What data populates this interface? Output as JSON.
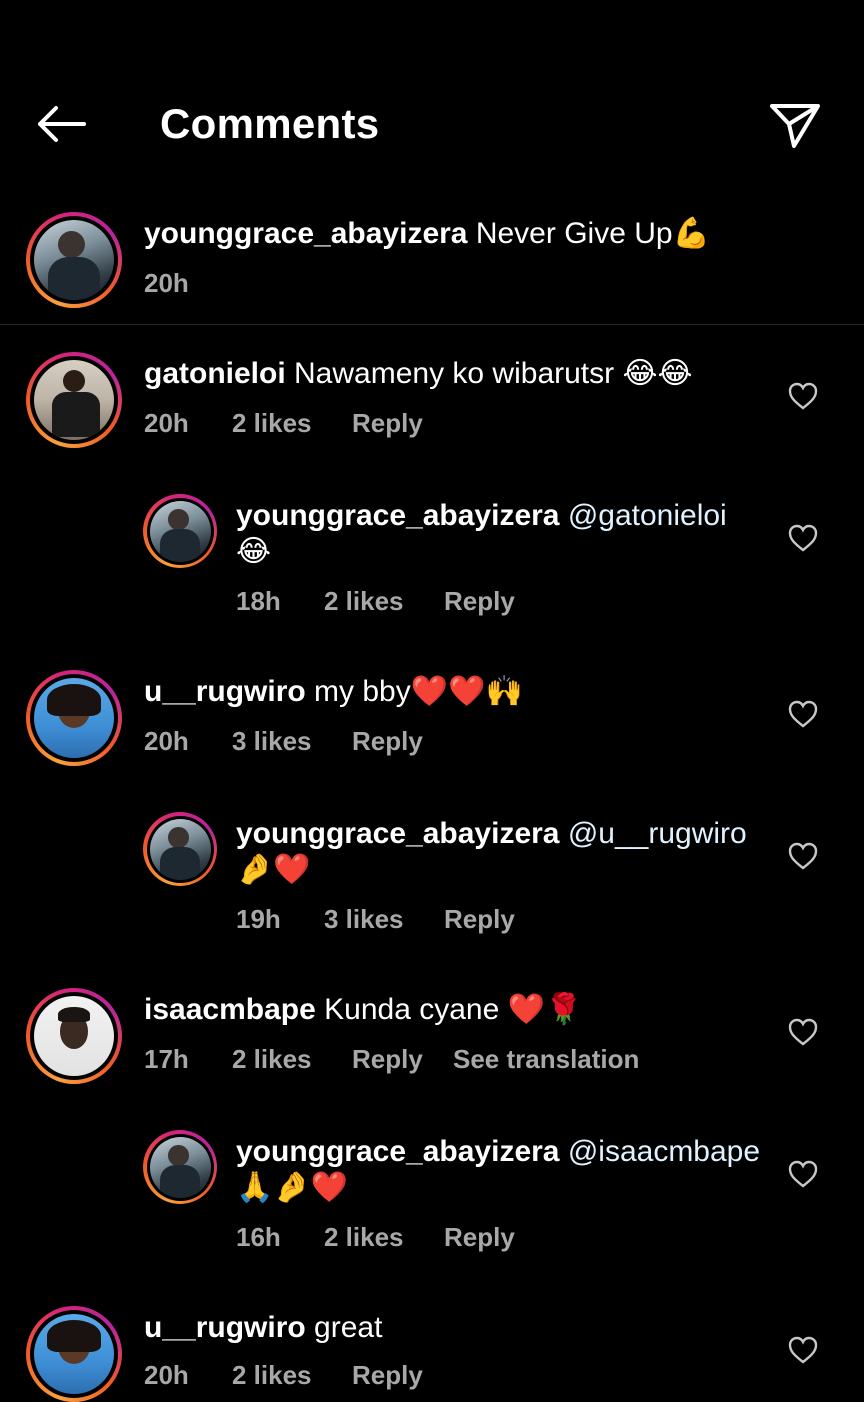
{
  "header": {
    "title": "Comments",
    "back_icon": "arrow-left-icon",
    "send_icon": "paper-plane-icon"
  },
  "caption": {
    "username": "younggrace_abayizera",
    "text": "Never Give Up💪",
    "time": "20h"
  },
  "comments": [
    {
      "username": "gatonieloi",
      "text": "Nawameny ko wibarutsr 😂😂",
      "time": "20h",
      "likes": "2 likes",
      "reply": "Reply",
      "reply_comment": {
        "username": "younggrace_abayizera",
        "mention": "@gatonieloi",
        "text": "😂",
        "time": "18h",
        "likes": "2 likes",
        "reply": "Reply"
      }
    },
    {
      "username": "u__rugwiro",
      "text": "my bby❤️❤️🙌",
      "time": "20h",
      "likes": "3 likes",
      "reply": "Reply",
      "reply_comment": {
        "username": "younggrace_abayizera",
        "mention": "@u__rugwiro",
        "text": "🤌❤️",
        "time": "19h",
        "likes": "3 likes",
        "reply": "Reply"
      }
    },
    {
      "username": "isaacmbape",
      "text": "Kunda cyane ❤️🌹",
      "time": "17h",
      "likes": "2 likes",
      "reply": "Reply",
      "translation": "See translation",
      "reply_comment": {
        "username": "younggrace_abayizera",
        "mention": "@isaacmbape",
        "text": "🙏🤌❤️",
        "time": "16h",
        "likes": "2 likes",
        "reply": "Reply"
      }
    },
    {
      "username": "u__rugwiro",
      "text": "great",
      "time": "20h",
      "likes": "2 likes",
      "reply": "Reply"
    }
  ],
  "colors": {
    "background": "#000000",
    "meta_text": "#a8a8a8",
    "mention": "#e0f1ff"
  }
}
